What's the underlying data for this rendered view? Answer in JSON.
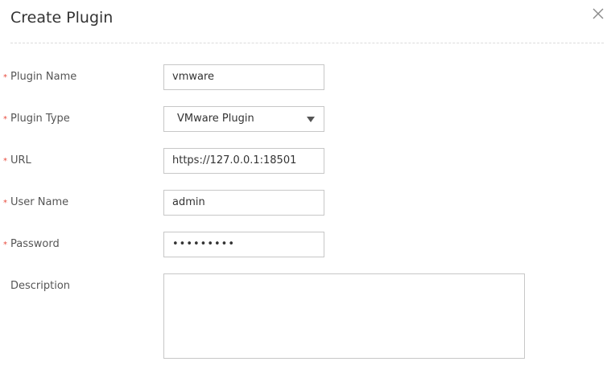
{
  "dialog": {
    "title": "Create Plugin",
    "close_icon": "close-icon"
  },
  "form": {
    "required_marker": "*",
    "plugin_name": {
      "label": "Plugin Name",
      "value": "vmware"
    },
    "plugin_type": {
      "label": "Plugin Type",
      "value": "VMware Plugin"
    },
    "url": {
      "label": "URL",
      "value": "https://127.0.0.1:18501"
    },
    "user_name": {
      "label": "User Name",
      "value": "admin"
    },
    "password": {
      "label": "Password",
      "value": "•••••••••"
    },
    "description": {
      "label": "Description",
      "value": ""
    }
  },
  "colors": {
    "required": "#e84a3c",
    "border": "#c7c7c7",
    "text": "#333333"
  }
}
